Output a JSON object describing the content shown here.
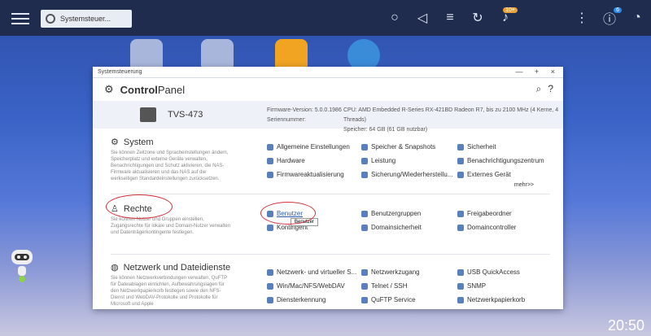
{
  "taskbar": {
    "app_tab_label": "Systemsteuer...",
    "badge_notifications": "10+",
    "badge_info": "6"
  },
  "window": {
    "title": "Systemsteuerung",
    "controls": "— + ×"
  },
  "header": {
    "title_bold": "Control",
    "title_rest": "Panel"
  },
  "device": {
    "name": "TVS-473",
    "firmware_label": "Firmware-Version:",
    "firmware_value": "5.0.0.1986",
    "serial_label": "Seriennummer:",
    "cpu_label": "CPU:",
    "cpu_value": "AMD Embedded R-Series RX-421BD Radeon R7, bis zu 2100 MHz (4 Kerne, 4 Threads)",
    "memory_label": "Speicher:",
    "memory_value": "64 GB (61 GB nutzbar)"
  },
  "sections": [
    {
      "title": "System",
      "desc": "Sie können Zeitzone und Spracheinstellungen ändern, Speicherplatz und externe Geräte verwalten, Benachrichtigungen und Schutz aktivieren, die NAS-Firmware aktualisieren und das NAS auf die werkseitigen Standardeinstellungen zurücksetzen.",
      "items": [
        "Allgemeine Einstellungen",
        "Speicher & Snapshots",
        "Sicherheit",
        "Hardware",
        "Leistung",
        "Benachrichtigungszentrum",
        "Firmwareaktualisierung",
        "Sicherung/Wiederherstellu...",
        "Externes Gerät"
      ],
      "more": "mehr>>"
    },
    {
      "title": "Rechte",
      "desc": "Sie können Nutzer und Gruppen einstellen, Zugangsrechte für lokale und Domain-Nutzer verwalten und Datenträgerkontingente festlegen.",
      "items": [
        "Benutzer",
        "Benutzergruppen",
        "Freigabeordner",
        "Kontingent",
        "Domainsicherheit",
        "Domaincontroller"
      ],
      "tooltip": "Benutzer"
    },
    {
      "title": "Netzwerk und Dateidienste",
      "desc": "Sie können Netzwerkverbindungen verwalten, QuFTP für Dateiablagen einrichten, Aufbewahrungslagen für den Netzwerkpapierkorb festlegen sowie den NFS-Dienst und WebDAV-Protokolle und Protokolle für Microsoft und Apple",
      "items": [
        "Netzwerk- und virtueller S...",
        "Netzwerkzugang",
        "USB QuickAccess",
        "Win/Mac/NFS/WebDAV",
        "Telnet / SSH",
        "SNMP",
        "Diensterkennung",
        "QuFTP Service",
        "Netzwerkpapierkorb"
      ]
    }
  ],
  "clock": "20:50"
}
